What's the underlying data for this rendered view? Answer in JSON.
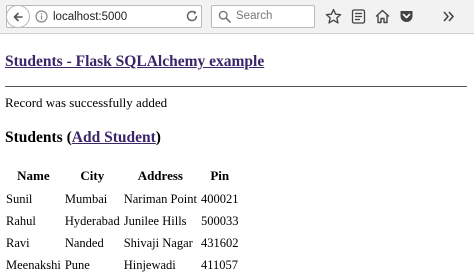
{
  "browser": {
    "url": "localhost:5000",
    "search_placeholder": "Search",
    "icons": [
      "back-icon",
      "info-icon",
      "reload-icon",
      "search-icon",
      "bookmark-star-icon",
      "reading-list-icon",
      "home-icon",
      "pocket-icon",
      "overflow-icon"
    ]
  },
  "page": {
    "heading": "Students - Flask SQLAlchemy example",
    "flash_message": "Record was successfully added",
    "section_title": "Students",
    "paren_open": "(",
    "add_link": "Add Student",
    "paren_close": ")"
  },
  "table": {
    "headers": [
      "Name",
      "City",
      "Address",
      "Pin"
    ],
    "rows": [
      [
        "Sunil",
        "Mumbai",
        "Nariman Point",
        "400021"
      ],
      [
        "Rahul",
        "Hyderabad",
        "Junilee Hills",
        "500033"
      ],
      [
        "Ravi",
        "Nanded",
        "Shivaji Nagar",
        "431602"
      ],
      [
        "Meenakshi",
        "Pune",
        "Hinjewadi",
        "411057"
      ]
    ]
  },
  "colors": {
    "link": "#3a2569",
    "toolbar": "#f2f2f2"
  }
}
